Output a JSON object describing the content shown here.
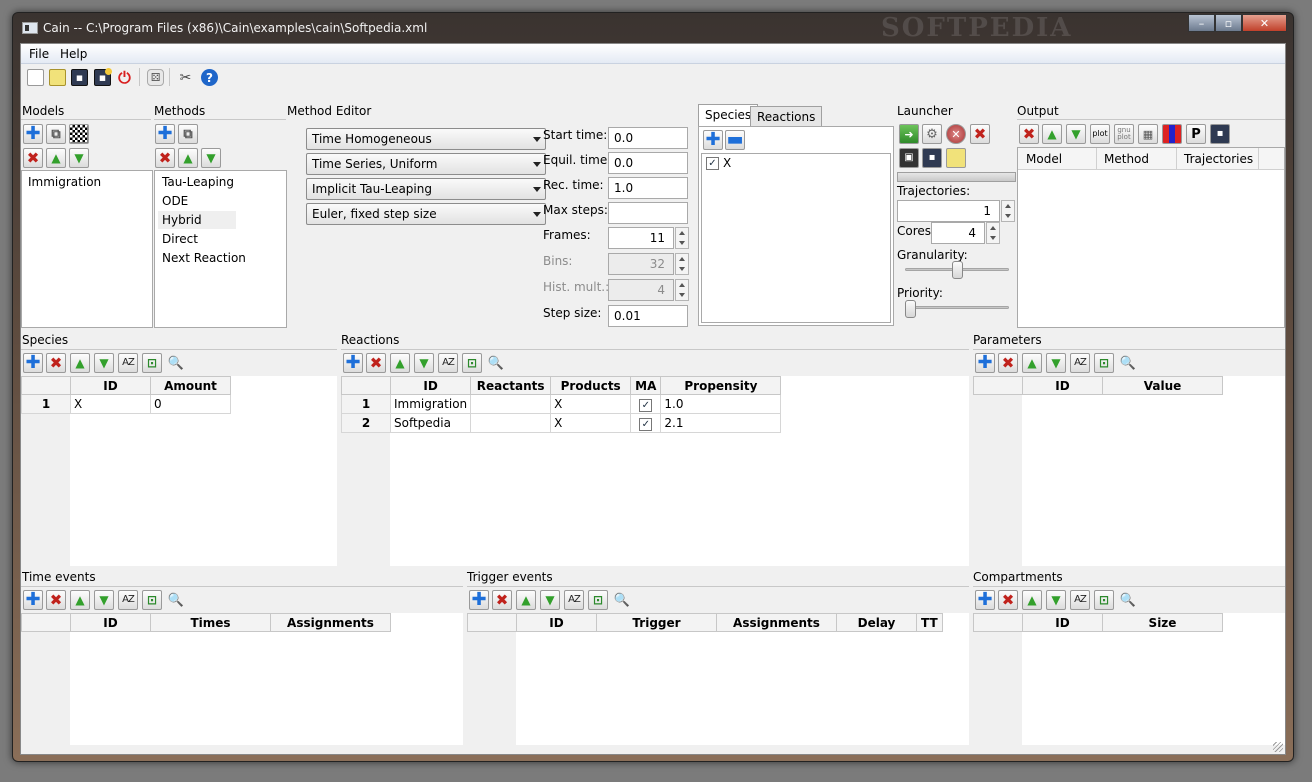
{
  "window": {
    "title": "Cain -- C:\\Program Files (x86)\\Cain\\examples\\cain\\Softpedia.xml",
    "watermark": "SOFTPEDIA"
  },
  "menu": {
    "file": "File",
    "help": "Help"
  },
  "panels": {
    "models": "Models",
    "methods": "Methods",
    "method_editor": "Method Editor",
    "launcher": "Launcher",
    "output": "Output",
    "species": "Species",
    "reactions": "Reactions",
    "parameters": "Parameters",
    "time_events": "Time events",
    "trigger_events": "Trigger events",
    "compartments": "Compartments"
  },
  "models_list": [
    "Immigration"
  ],
  "methods_list": [
    "Tau-Leaping",
    "ODE",
    "Hybrid",
    "Direct",
    "Next Reaction"
  ],
  "method_selected": "Hybrid",
  "method_editor": {
    "combos": [
      "Time Homogeneous",
      "Time Series, Uniform",
      "Implicit Tau-Leaping",
      "Euler, fixed step size"
    ],
    "fields": {
      "start_time": {
        "label": "Start time:",
        "value": "0.0"
      },
      "equil_time": {
        "label": "Equil. time:",
        "value": "0.0"
      },
      "rec_time": {
        "label": "Rec. time:",
        "value": "1.0"
      },
      "max_steps": {
        "label": "Max steps:",
        "value": ""
      },
      "frames": {
        "label": "Frames:",
        "value": "11"
      },
      "bins": {
        "label": "Bins:",
        "value": "32"
      },
      "hist_mult": {
        "label": "Hist. mult.:",
        "value": "4"
      },
      "step_size": {
        "label": "Step size:",
        "value": "0.01"
      }
    }
  },
  "model_tabs": {
    "species": "Species",
    "reactions": "Reactions"
  },
  "species_check": {
    "label": "X",
    "checked": true
  },
  "launcher": {
    "trajectories_label": "Trajectories:",
    "trajectories": "1",
    "cores_label": "Cores:",
    "cores": "4",
    "granularity_label": "Granularity:",
    "granularity": 0.5,
    "priority_label": "Priority:",
    "priority": 0.0
  },
  "output_table": {
    "columns": [
      "Model",
      "Method",
      "Trajectories"
    ]
  },
  "output_icons": {
    "plot": "plot",
    "gnuplot": "gnu\nplot",
    "p": "P"
  },
  "species_table": {
    "columns": [
      "ID",
      "Amount"
    ],
    "rows": [
      {
        "n": "1",
        "id": "X",
        "amount": "0"
      }
    ]
  },
  "reactions_table": {
    "columns": [
      "ID",
      "Reactants",
      "Products",
      "MA",
      "Propensity"
    ],
    "rows": [
      {
        "n": "1",
        "id": "Immigration",
        "reactants": "",
        "products": "X",
        "ma": true,
        "propensity": "1.0"
      },
      {
        "n": "2",
        "id": "Softpedia",
        "reactants": "",
        "products": "X",
        "ma": true,
        "propensity": "2.1"
      }
    ]
  },
  "parameters_table": {
    "columns": [
      "ID",
      "Value"
    ]
  },
  "time_events_table": {
    "columns": [
      "ID",
      "Times",
      "Assignments"
    ]
  },
  "trigger_events_table": {
    "columns": [
      "ID",
      "Trigger",
      "Assignments",
      "Delay",
      "TT"
    ]
  },
  "compartments_table": {
    "columns": [
      "ID",
      "Size"
    ]
  },
  "colors": {
    "accent_blue": "#1e6fd9",
    "delete_red": "#c0221c",
    "arrow_green": "#33a02c"
  }
}
